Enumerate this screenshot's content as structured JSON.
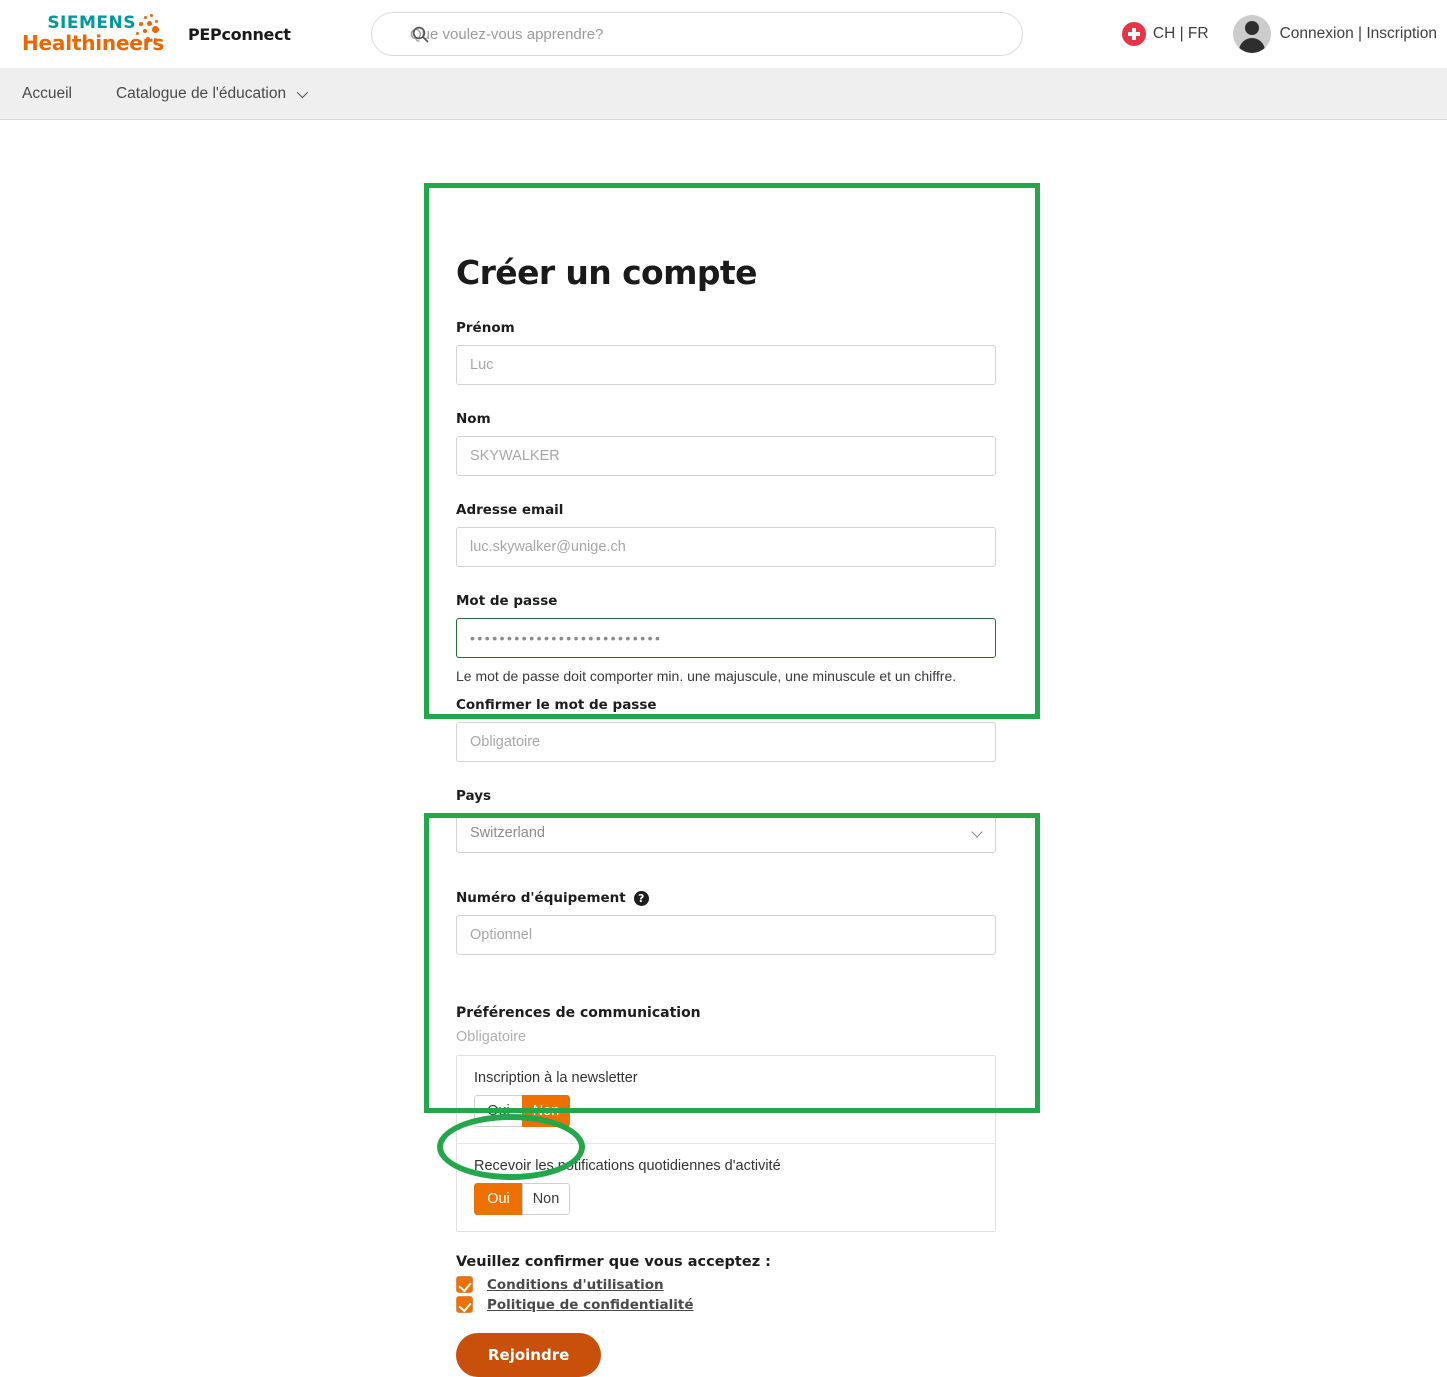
{
  "header": {
    "logo_top": "SIEMENS",
    "logo_bottom": "Healthineers",
    "app_name": "PEPconnect",
    "search_placeholder": "Que voulez-vous apprendre?",
    "search_value": "",
    "search_icon": "search-icon",
    "locale": "CH | FR",
    "flag_icon": "swiss-flag-icon",
    "avatar_icon": "user-avatar-icon",
    "account": "Connexion | Inscription"
  },
  "nav": {
    "items": [
      {
        "label": "Accueil",
        "has_caret": false
      },
      {
        "label": "Catalogue de l'éducation",
        "has_caret": true
      }
    ]
  },
  "form": {
    "title": "Créer un compte",
    "first_name": {
      "label": "Prénom",
      "placeholder": "Luc",
      "value": ""
    },
    "last_name": {
      "label": "Nom",
      "placeholder": "SKYWALKER",
      "value": ""
    },
    "email": {
      "label": "Adresse email",
      "placeholder": "luc.skywalker@unige.ch",
      "value": ""
    },
    "password": {
      "label": "Mot de passe",
      "value": "••••••••••••••••••••••••••",
      "hint": "Le mot de passe doit comporter min. une majuscule, une minuscule et un chiffre.",
      "state": "valid"
    },
    "confirm_password": {
      "label": "Confirmer le mot de passe",
      "placeholder": "Obligatoire",
      "value": ""
    },
    "country": {
      "label": "Pays",
      "selected": "Switzerland",
      "options": [
        "Switzerland"
      ],
      "caret_icon": "chevron-down-icon"
    },
    "equipment_number": {
      "label": "Numéro d'équipement",
      "help_icon": "question-mark-icon",
      "help_glyph": "?",
      "placeholder": "Optionnel",
      "value": ""
    },
    "preferences": {
      "title": "Préférences de communication",
      "required_note": "Obligatoire",
      "rows": [
        {
          "label": "Inscription à la newsletter",
          "yes_label": "Oui",
          "no_label": "Non",
          "selected": "Non"
        },
        {
          "label": "Recevoir les notifications quotidiennes d'activité",
          "yes_label": "Oui",
          "no_label": "Non",
          "selected": "Oui"
        }
      ]
    },
    "confirm": {
      "title": "Veuillez confirmer que vous acceptez :",
      "items": [
        {
          "label": "Conditions d'utilisation",
          "checked": true
        },
        {
          "label": "Politique de confidentialité",
          "checked": true
        }
      ]
    },
    "submit_label": "Rejoindre"
  },
  "colors": {
    "brand_teal": "#009999",
    "brand_orange": "#EC6602",
    "toggle_active_orange": "#ED7000",
    "submit_orange": "#C8500A",
    "annotation_green": "#22A84B",
    "flag_red": "#E8344A",
    "valid_border_green": "#2B6B37"
  }
}
